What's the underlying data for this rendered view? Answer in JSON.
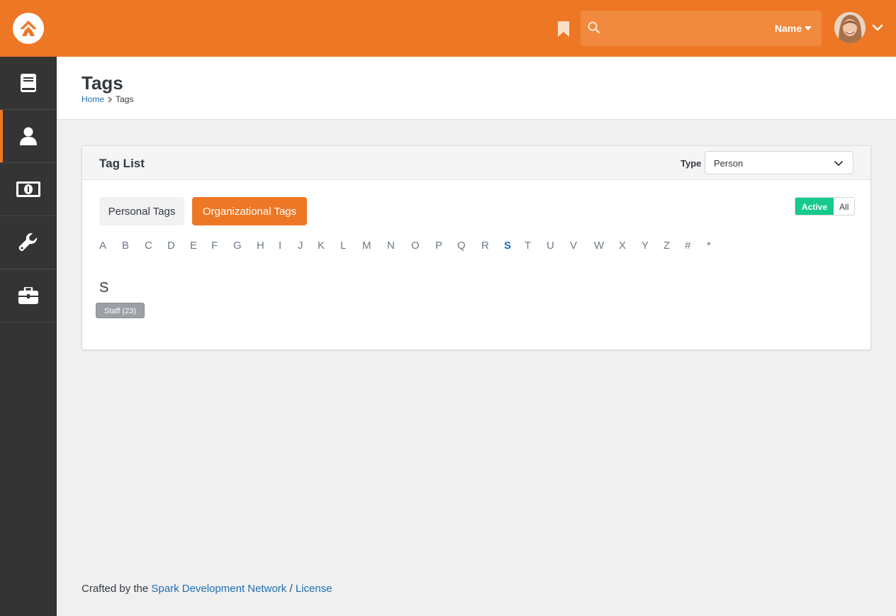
{
  "colors": {
    "brand": "#ee7725",
    "sidebar": "#343434",
    "active_toggle": "#16c98d",
    "link": "#1e6fb3",
    "badge": "#9aa0a6"
  },
  "header": {
    "search": {
      "placeholder": "",
      "filter_label": "Name"
    },
    "icons": [
      "rock-logo-icon",
      "bookmark-icon",
      "search-icon",
      "caret-down-icon",
      "avatar",
      "chevron-down-icon"
    ]
  },
  "sidebar": {
    "items": [
      {
        "icon": "book-icon"
      },
      {
        "icon": "person-icon",
        "active": true
      },
      {
        "icon": "money-icon"
      },
      {
        "icon": "wrench-icon"
      },
      {
        "icon": "briefcase-icon"
      }
    ]
  },
  "page": {
    "title": "Tags",
    "breadcrumb": {
      "home": "Home",
      "current": "Tags"
    }
  },
  "panel": {
    "title": "Tag List",
    "type_label": "Type",
    "type_value": "Person",
    "buttons": {
      "personal": "Personal Tags",
      "organizational": "Organizational Tags",
      "selected": "Organizational Tags"
    },
    "status_toggle": {
      "active": "Active",
      "all": "All",
      "selected": "Active"
    },
    "letters": [
      "A",
      "B",
      "C",
      "D",
      "E",
      "F",
      "G",
      "H",
      "I",
      "J",
      "K",
      "L",
      "M",
      "N",
      "O",
      "P",
      "Q",
      "R",
      "S",
      "T",
      "U",
      "V",
      "W",
      "X",
      "Y",
      "Z",
      "#",
      "*"
    ],
    "selected_letter": "S",
    "group_letter": "S",
    "tags": [
      {
        "label": "Staff (23)"
      }
    ]
  },
  "footer": {
    "prefix": "Crafted by the",
    "link1": "Spark Development Network",
    "separator": "/",
    "link2": "License"
  }
}
